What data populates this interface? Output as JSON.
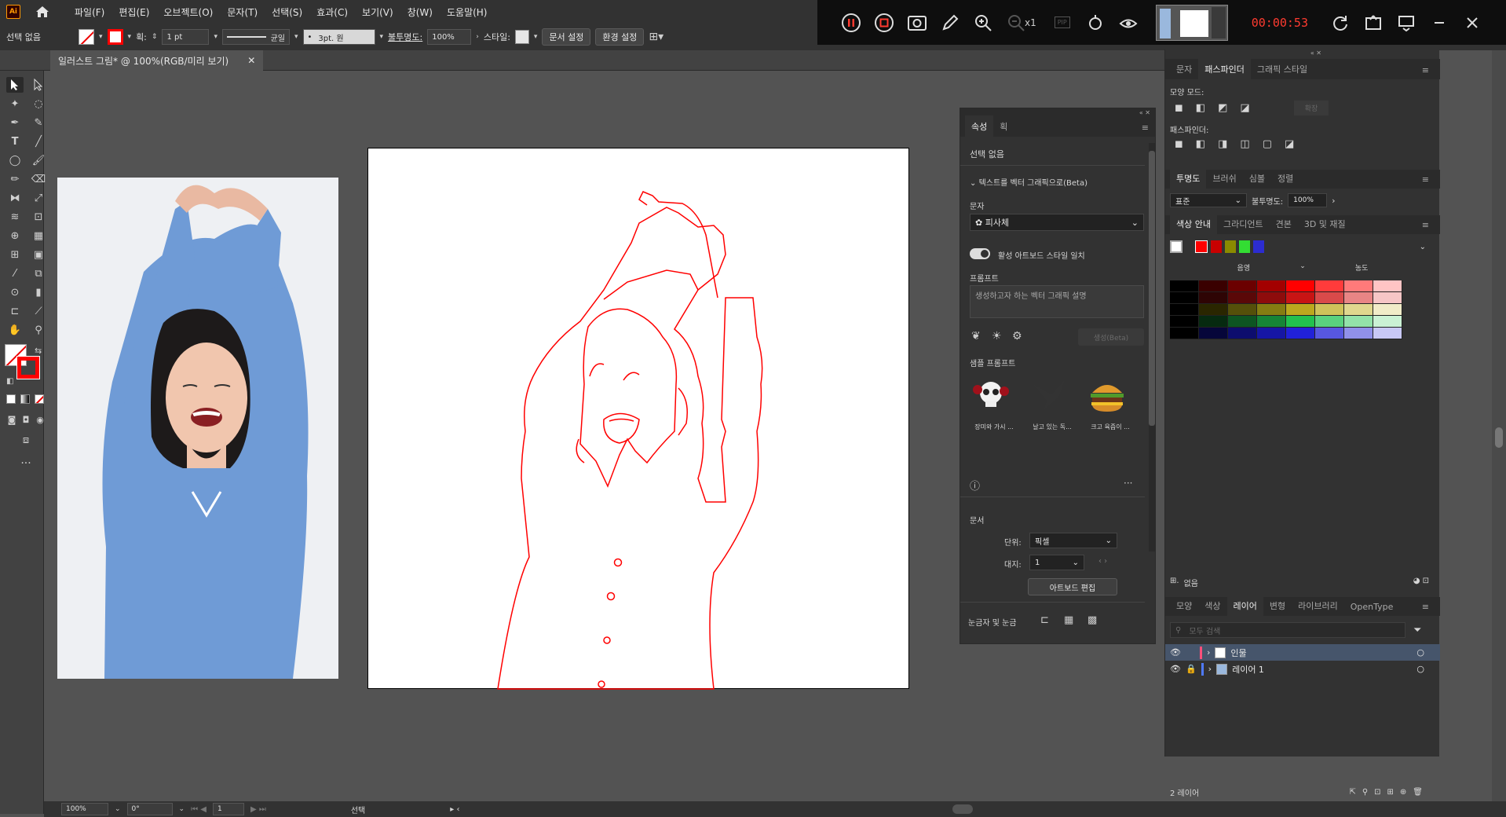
{
  "app": {
    "logo": "Ai",
    "window_title": "일러스트 그림* @ 100%(RGB/미리 보기)"
  },
  "menu": [
    "파일(F)",
    "편집(E)",
    "오브젝트(O)",
    "문자(T)",
    "선택(S)",
    "효과(C)",
    "보기(V)",
    "창(W)",
    "도움말(H)"
  ],
  "recorder": {
    "timer": "00:00:53",
    "zoom_label": "x1",
    "pip_label": "PIP"
  },
  "controlbar": {
    "selection": "선택 없음",
    "stroke_label": "획:",
    "stroke_weight": "1 pt",
    "stroke_profile": "균일",
    "brush": "3pt. 원",
    "opacity_label": "불투명도:",
    "opacity": "100%",
    "style_label": "스타일:",
    "doc_setup": "문서 설정",
    "prefs": "환경 설정"
  },
  "properties": {
    "tabs": [
      "속성",
      "획"
    ],
    "selection": "선택 없음",
    "section_vector": "텍스트를 벡터 그래픽으로(Beta)",
    "subject_label": "문자",
    "subject_value": "피사체",
    "toggle_label": "활성 아트보드 스타일 일치",
    "prompt_label": "프롬프트",
    "prompt_placeholder": "생성하고자 하는 벡터 그래픽 설명",
    "generate_btn": "생성(Beta)",
    "samples_label": "샘플 프롬프트",
    "samples": [
      "장미와 가시 ...",
      "날고 있는 독...",
      "크고 육즙이 ..."
    ],
    "doc_label": "문서",
    "unit_label": "단위:",
    "unit_value": "픽셀",
    "artboard_label": "대지:",
    "artboard_value": "1",
    "edit_artboard": "아트보드 편집",
    "rulers_label": "눈금자 및 눈금"
  },
  "pathfinder": {
    "tabs": [
      "문자",
      "패스파인더",
      "그래픽 스타일"
    ],
    "shape_modes": "모양 모드:",
    "expand": "확장",
    "pathfinders": "패스파인더:"
  },
  "transparency": {
    "tabs": [
      "투명도",
      "브러쉬",
      "심볼",
      "정렬"
    ],
    "mode": "표준",
    "opacity_label": "불투명도:",
    "opacity": "100%"
  },
  "color_guide": {
    "tabs": [
      "색상 안내",
      "그라디언트",
      "견본",
      "3D 및 재질"
    ],
    "shade_label": "음영",
    "tint_label": "농도",
    "footer": "없음",
    "palette_rows": [
      [
        "#000000",
        "#3a0000",
        "#6b0000",
        "#a30000",
        "#ff0000",
        "#ff3b3b",
        "#ff7a7a",
        "#ffc4c4"
      ],
      [
        "#000000",
        "#2e0404",
        "#5a0808",
        "#8e0c0c",
        "#c81414",
        "#d94a4a",
        "#e88585",
        "#f6c6c6"
      ],
      [
        "#000000",
        "#2a2600",
        "#55500a",
        "#857d12",
        "#bba81e",
        "#cfc25a",
        "#e0d78e",
        "#f1ecc8"
      ],
      [
        "#000000",
        "#062a10",
        "#0d5522",
        "#168436",
        "#22c04e",
        "#5ad17e",
        "#93e2a9",
        "#caf2d4"
      ],
      [
        "#000000",
        "#06063a",
        "#0d0d6e",
        "#1616a4",
        "#2121d8",
        "#5757e0",
        "#9090ea",
        "#c8c8f5"
      ]
    ]
  },
  "layers": {
    "tabs": [
      "모양",
      "색상",
      "레이어",
      "변형",
      "라이브러리",
      "OpenType"
    ],
    "search_placeholder": "모두 검색",
    "items": [
      "인물",
      "레이어 1"
    ],
    "count": "2 레이어"
  },
  "status": {
    "zoom": "100%",
    "rotation": "0°",
    "artboard": "1",
    "tool": "선택"
  },
  "colors": {
    "accent_red": "#ff0000",
    "panel": "#323232",
    "canvas": "#535353"
  }
}
